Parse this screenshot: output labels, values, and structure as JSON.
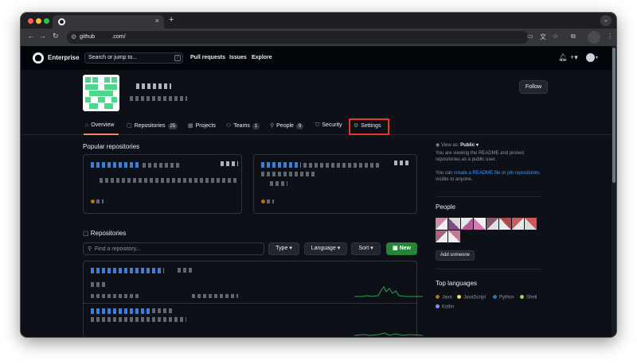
{
  "browser": {
    "tab_close": "×",
    "new_tab": "+",
    "url": "github           .com/",
    "nav": {
      "back": "←",
      "forward": "→",
      "reload": "↻"
    }
  },
  "header": {
    "brand": "Enterprise",
    "search_placeholder": "Search or jump to...",
    "search_kbd": "/",
    "nav": [
      "Pull requests",
      "Issues",
      "Explore"
    ],
    "plus": "+▾"
  },
  "org": {
    "follow_label": "Follow"
  },
  "tabs": [
    {
      "label": "Overview",
      "icon": "home-icon",
      "glyph": "⌂"
    },
    {
      "label": "Repositories",
      "icon": "repo-icon",
      "glyph": "▢",
      "count": "25"
    },
    {
      "label": "Projects",
      "icon": "project-icon",
      "glyph": "▦"
    },
    {
      "label": "Teams",
      "icon": "people-icon",
      "glyph": "⚇",
      "count": "1"
    },
    {
      "label": "People",
      "icon": "person-icon",
      "glyph": "⚲",
      "count": "9"
    },
    {
      "label": "Security",
      "icon": "shield-icon",
      "glyph": "⛉"
    },
    {
      "label": "Settings",
      "icon": "gear-icon",
      "glyph": "⚙"
    }
  ],
  "popular": {
    "title": "Popular repositories"
  },
  "sidebar": {
    "view_as_label": "View as:",
    "view_as_value": "Public",
    "view_as_desc": "You are viewing the README and pinned repositories as a public user.",
    "can_create_prefix": "You can",
    "create_readme": "create a README file",
    "or": "or",
    "pin_repos": "pin repositories",
    "visible": "visible to anyone.",
    "people_title": "People",
    "add_someone": "Add someone",
    "languages_title": "Top languages",
    "languages": [
      {
        "name": "Java",
        "color": "#b07219"
      },
      {
        "name": "JavaScript",
        "color": "#f1e05a"
      },
      {
        "name": "Python",
        "color": "#3572a5"
      },
      {
        "name": "Shell",
        "color": "#89e051"
      },
      {
        "name": "Kotlin",
        "color": "#a97bff"
      }
    ]
  },
  "repos": {
    "title": "Repositories",
    "find_placeholder": "Find a repository...",
    "type_label": "Type",
    "language_label": "Language",
    "sort_label": "Sort",
    "new_label": "New"
  },
  "colors": {
    "accent": "#f78166",
    "link": "#4493f8",
    "success": "#238636",
    "highlight": "#e5372c"
  }
}
